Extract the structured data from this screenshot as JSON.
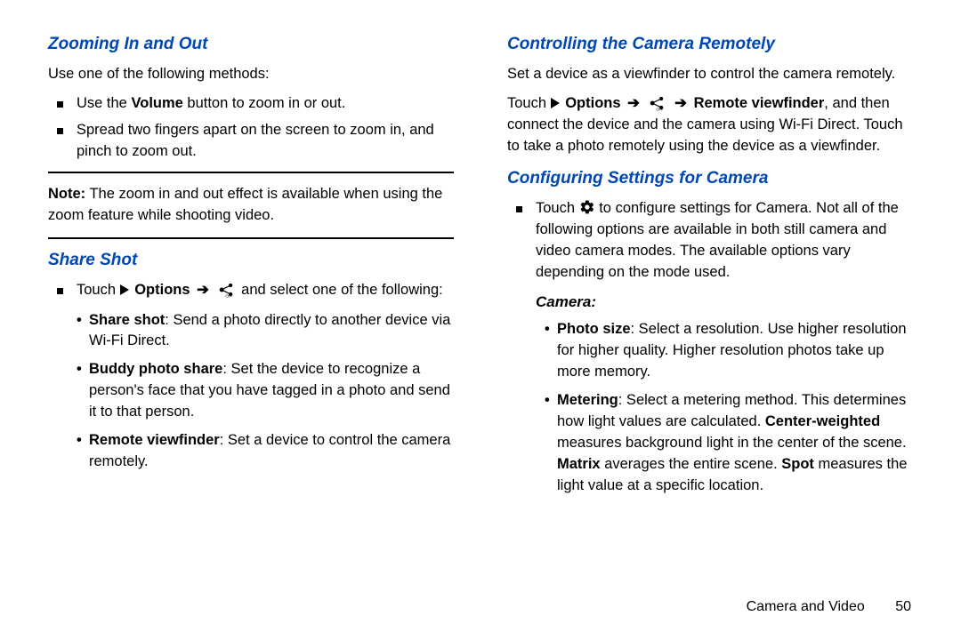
{
  "left": {
    "h_zoom": "Zooming In and Out",
    "zoom_intro": "Use one of the following methods:",
    "zoom_b1_a": "Use the ",
    "zoom_b1_bold": "Volume",
    "zoom_b1_b": " button to zoom in or out.",
    "zoom_b2": "Spread two fingers apart on the screen to zoom in, and pinch to zoom out.",
    "note_label": "Note:",
    "note_text": " The zoom in and out effect is available when using the zoom feature while shooting video.",
    "h_share": "Share Shot",
    "share_b1_a": "Touch ",
    "share_b1_opts": "Options",
    "share_b1_b": " and select one of the following:",
    "share_sub1_bold": "Share shot",
    "share_sub1": ": Send a photo directly to another device via Wi-Fi Direct.",
    "share_sub2_bold": "Buddy photo share",
    "share_sub2": ": Set the device to recognize a person's face that you have tagged in a photo and send it to that person.",
    "share_sub3_bold": "Remote viewfinder",
    "share_sub3": ": Set a device to control the camera remotely."
  },
  "right": {
    "h_remote": "Controlling the Camera Remotely",
    "remote_intro": "Set a device as a viewfinder to control the camera remotely.",
    "remote_line_a": "Touch ",
    "remote_opts": "Options",
    "remote_rv": "Remote viewfinder",
    "remote_line_b": ", and then connect the device and the camera using Wi-Fi Direct. Touch to take a photo remotely using the device as a viewfinder.",
    "h_config": "Configuring Settings for Camera",
    "config_b1_a": "Touch ",
    "config_b1_b": " to configure settings for Camera. Not all of the following options are available in both still camera and video camera modes. The available options vary depending on the mode used.",
    "sub_camera": "Camera:",
    "cam_sub1_bold": "Photo size",
    "cam_sub1": ": Select a resolution. Use higher resolution for higher quality. Higher resolution photos take up more memory.",
    "cam_sub2_bold": "Metering",
    "cam_sub2_a": ": Select a metering method. This determines how light values are calculated. ",
    "cam_sub2_cw": "Center-weighted",
    "cam_sub2_b": " measures background light in the center of the scene. ",
    "cam_sub2_mx": "Matrix",
    "cam_sub2_c": " averages the entire scene. ",
    "cam_sub2_sp": "Spot",
    "cam_sub2_d": " measures the light value at a specific location."
  },
  "footer": {
    "section": "Camera and Video",
    "page": "50"
  }
}
